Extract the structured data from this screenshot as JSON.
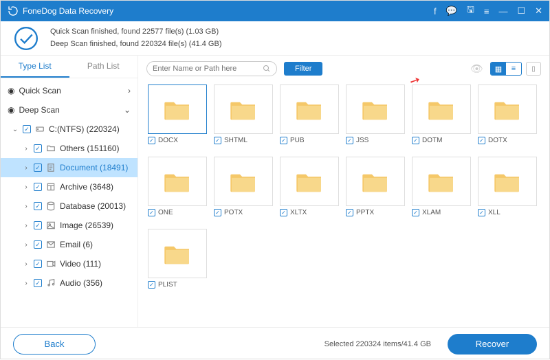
{
  "app": {
    "title": "FoneDog Data Recovery"
  },
  "status": {
    "quick": "Quick Scan finished, found 22577 file(s) (1.03 GB)",
    "deep": "Deep Scan finished, found 220324 file(s) (41.4 GB)"
  },
  "tabs": {
    "type": "Type List",
    "path": "Path List"
  },
  "tree": {
    "quick": "Quick Scan",
    "deep": "Deep Scan",
    "drive": "C:(NTFS) (220324)",
    "items": [
      {
        "label": "Others (151160)",
        "icon": "folder"
      },
      {
        "label": "Document (18491)",
        "icon": "document",
        "selected": true
      },
      {
        "label": "Archive (3648)",
        "icon": "archive"
      },
      {
        "label": "Database (20013)",
        "icon": "database"
      },
      {
        "label": "Image (26539)",
        "icon": "image"
      },
      {
        "label": "Email (6)",
        "icon": "email"
      },
      {
        "label": "Video (111)",
        "icon": "video"
      },
      {
        "label": "Audio (356)",
        "icon": "audio"
      }
    ]
  },
  "toolbar": {
    "search_placeholder": "Enter Name or Path here",
    "filter": "Filter"
  },
  "grid": [
    "DOCX",
    "SHTML",
    "PUB",
    "JSS",
    "DOTM",
    "DOTX",
    "ONE",
    "POTX",
    "XLTX",
    "PPTX",
    "XLAM",
    "XLL",
    "PLIST"
  ],
  "footer": {
    "back": "Back",
    "info": "Selected 220324 items/41.4 GB",
    "recover": "Recover"
  }
}
